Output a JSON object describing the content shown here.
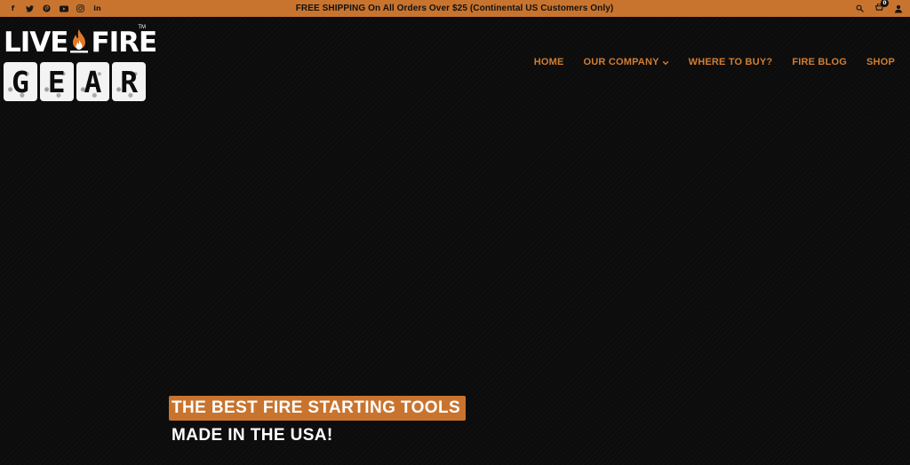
{
  "topbar": {
    "background": "#c8742f",
    "socials": [
      {
        "icon": "facebook-icon",
        "glyph": "f"
      },
      {
        "icon": "twitter-icon",
        "glyph": "🐦"
      },
      {
        "icon": "pinterest-icon",
        "glyph": "℗"
      },
      {
        "icon": "youtube-icon",
        "glyph": "▶"
      },
      {
        "icon": "instagram-icon",
        "glyph": "◎"
      },
      {
        "icon": "linkedin-icon",
        "glyph": "in"
      }
    ],
    "promo": "FREE SHIPPING On All Orders Over $25 (Continental US Customers Only)",
    "cart_count": "0"
  },
  "logo": {
    "word_live": "LIVE",
    "word_fire": "FIRE",
    "tm": "TM",
    "gear_letters": [
      "G",
      "E",
      "A",
      "R"
    ]
  },
  "nav": {
    "color": "#d37d32",
    "items": [
      {
        "label": "HOME"
      },
      {
        "label": "OUR COMPANY"
      },
      {
        "label": "WHERE TO BUY?"
      },
      {
        "label": "FIRE BLOG"
      },
      {
        "label": "SHOP"
      }
    ]
  },
  "hero": {
    "line1": "THE BEST FIRE STARTING TOOLS",
    "line2": "MADE IN THE USA!",
    "accent": "#c8742f"
  }
}
